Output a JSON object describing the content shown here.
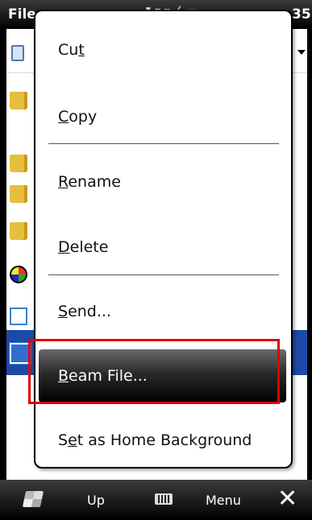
{
  "titlebar": {
    "title": "File",
    "clock": "35"
  },
  "menu": {
    "items": [
      {
        "pre": "Cu",
        "ul": "t",
        "post": ""
      },
      {
        "pre": "",
        "ul": "C",
        "post": "opy"
      },
      {
        "pre": "",
        "ul": "R",
        "post": "ename"
      },
      {
        "pre": "",
        "ul": "D",
        "post": "elete"
      },
      {
        "pre": "",
        "ul": "S",
        "post": "end..."
      },
      {
        "pre": "",
        "ul": "B",
        "post": "eam File..."
      },
      {
        "pre": "S",
        "ul": "e",
        "post": "t as Home Background"
      }
    ],
    "highlighted_item": "Beam File..."
  },
  "softbar": {
    "left_label": "Up",
    "right_label": "Menu"
  },
  "icons": {
    "start": "windows-start-icon",
    "keyboard": "keyboard-icon",
    "close": "close-icon"
  },
  "colors": {
    "callout": "#e00000",
    "selection": "#1b4aa8",
    "menu_highlight": "#2a2a2a"
  }
}
